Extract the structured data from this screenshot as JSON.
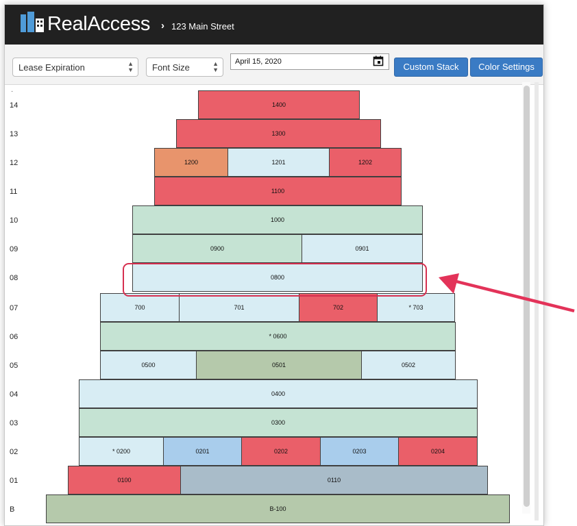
{
  "app": {
    "brand": "RealAccess",
    "breadcrumb_separator": "›",
    "breadcrumb": "123 Main Street"
  },
  "toolbar": {
    "view_select": "Lease Expiration",
    "font_select": "Font Size",
    "date": "April 15, 2020",
    "custom_stack_label": "Custom Stack",
    "color_settings_label": "Color Settings"
  },
  "stack": {
    "top_marker": "·",
    "floors": [
      {
        "label": "14",
        "suites": [
          {
            "name": "1400",
            "color": "#ea5f69"
          }
        ]
      },
      {
        "label": "13",
        "suites": [
          {
            "name": "1300",
            "color": "#ea5f69"
          }
        ]
      },
      {
        "label": "12",
        "suites": [
          {
            "name": "1200",
            "color": "#e8946c"
          },
          {
            "name": "1201",
            "color": "#d8edf4"
          },
          {
            "name": "1202",
            "color": "#ea5f69"
          }
        ]
      },
      {
        "label": "11",
        "suites": [
          {
            "name": "1100",
            "color": "#ea5f69"
          }
        ]
      },
      {
        "label": "10",
        "suites": [
          {
            "name": "1000",
            "color": "#c5e3d3"
          }
        ]
      },
      {
        "label": "09",
        "suites": [
          {
            "name": "0900",
            "color": "#c5e3d3"
          },
          {
            "name": "0901",
            "color": "#d8edf4"
          }
        ]
      },
      {
        "label": "08",
        "suites": [
          {
            "name": "0800",
            "color": "#d8edf4"
          }
        ]
      },
      {
        "label": "07",
        "suites": [
          {
            "name": "700",
            "color": "#d8edf4"
          },
          {
            "name": "701",
            "color": "#d8edf4"
          },
          {
            "name": "702",
            "color": "#ea5f69"
          },
          {
            "name": "* 703",
            "color": "#d8edf4"
          }
        ]
      },
      {
        "label": "06",
        "suites": [
          {
            "name": "* 0600",
            "color": "#c5e3d3"
          }
        ]
      },
      {
        "label": "05",
        "suites": [
          {
            "name": "0500",
            "color": "#d8edf4"
          },
          {
            "name": "0501",
            "color": "#b5c9ab"
          },
          {
            "name": "0502",
            "color": "#d8edf4"
          }
        ]
      },
      {
        "label": "04",
        "suites": [
          {
            "name": "0400",
            "color": "#d8edf4"
          }
        ]
      },
      {
        "label": "03",
        "suites": [
          {
            "name": "0300",
            "color": "#c5e3d3"
          }
        ]
      },
      {
        "label": "02",
        "suites": [
          {
            "name": "* 0200",
            "color": "#d8edf4"
          },
          {
            "name": "0201",
            "color": "#a9cdec"
          },
          {
            "name": "0202",
            "color": "#ea5f69"
          },
          {
            "name": "0203",
            "color": "#a9cdec"
          },
          {
            "name": "0204",
            "color": "#ea5f69"
          }
        ]
      },
      {
        "label": "01",
        "suites": [
          {
            "name": "0100",
            "color": "#ea5f69"
          },
          {
            "name": "0110",
            "color": "#a9bcc9"
          }
        ]
      },
      {
        "label": "B",
        "suites": [
          {
            "name": "B-100",
            "color": "#b5c9ab"
          }
        ]
      }
    ]
  },
  "colors": {
    "topbar": "#212121",
    "button": "#3a7bc4",
    "highlight": "#d62f4f",
    "arrow": "#e33359"
  },
  "icons": {
    "logo": "buildings-logo-icon",
    "breadcrumb": "chevron-right-icon",
    "calendar": "calendar-icon",
    "select": "up-down-caret-icon"
  }
}
